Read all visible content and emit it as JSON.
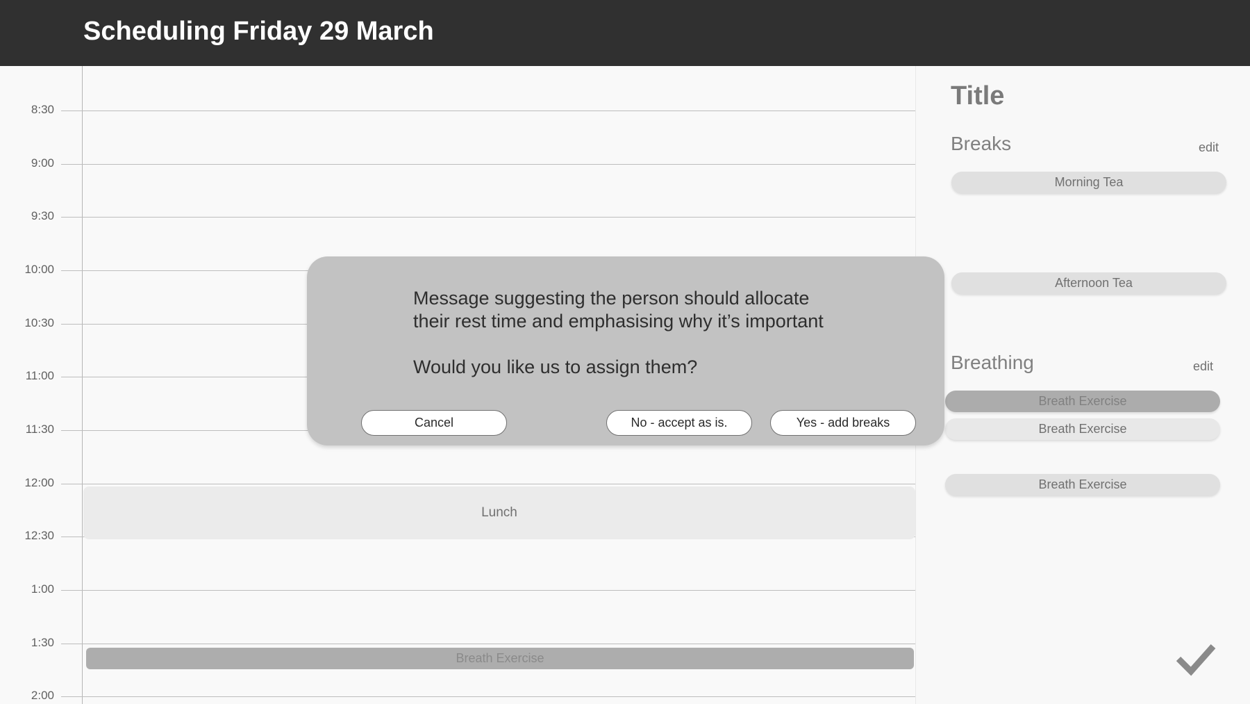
{
  "header": {
    "title": "Scheduling Friday 29 March"
  },
  "schedule": {
    "times": [
      "8:30",
      "9:00",
      "9:30",
      "10:00",
      "10:30",
      "11:00",
      "11:30",
      "12:00",
      "12:30",
      "1:00",
      "1:30",
      "2:00"
    ],
    "lunch_label": "Lunch",
    "breath_label": "Breath Exercise"
  },
  "side": {
    "title": "Title",
    "breaks": {
      "heading": "Breaks",
      "edit": "edit",
      "items": [
        "Morning Tea",
        "Afternoon Tea"
      ]
    },
    "breathing": {
      "heading": "Breathing",
      "edit": "edit",
      "items": [
        "Breath Exercise",
        "Breath Exercise",
        "Breath Exercise"
      ]
    }
  },
  "dialog": {
    "message_line1": "Message suggesting the person should allocate",
    "message_line2": "their rest time and emphasising why it’s important",
    "question": "Would you like us to assign them?",
    "cancel_label": "Cancel",
    "no_label": "No - accept as is.",
    "yes_label": "Yes - add breaks"
  },
  "colors": {
    "header_bg": "#303030",
    "dialog_bg": "#c2c2c2",
    "block_dark": "#adadad",
    "block_light": "#ebebeb"
  },
  "icons": {
    "confirm": "check-icon"
  }
}
